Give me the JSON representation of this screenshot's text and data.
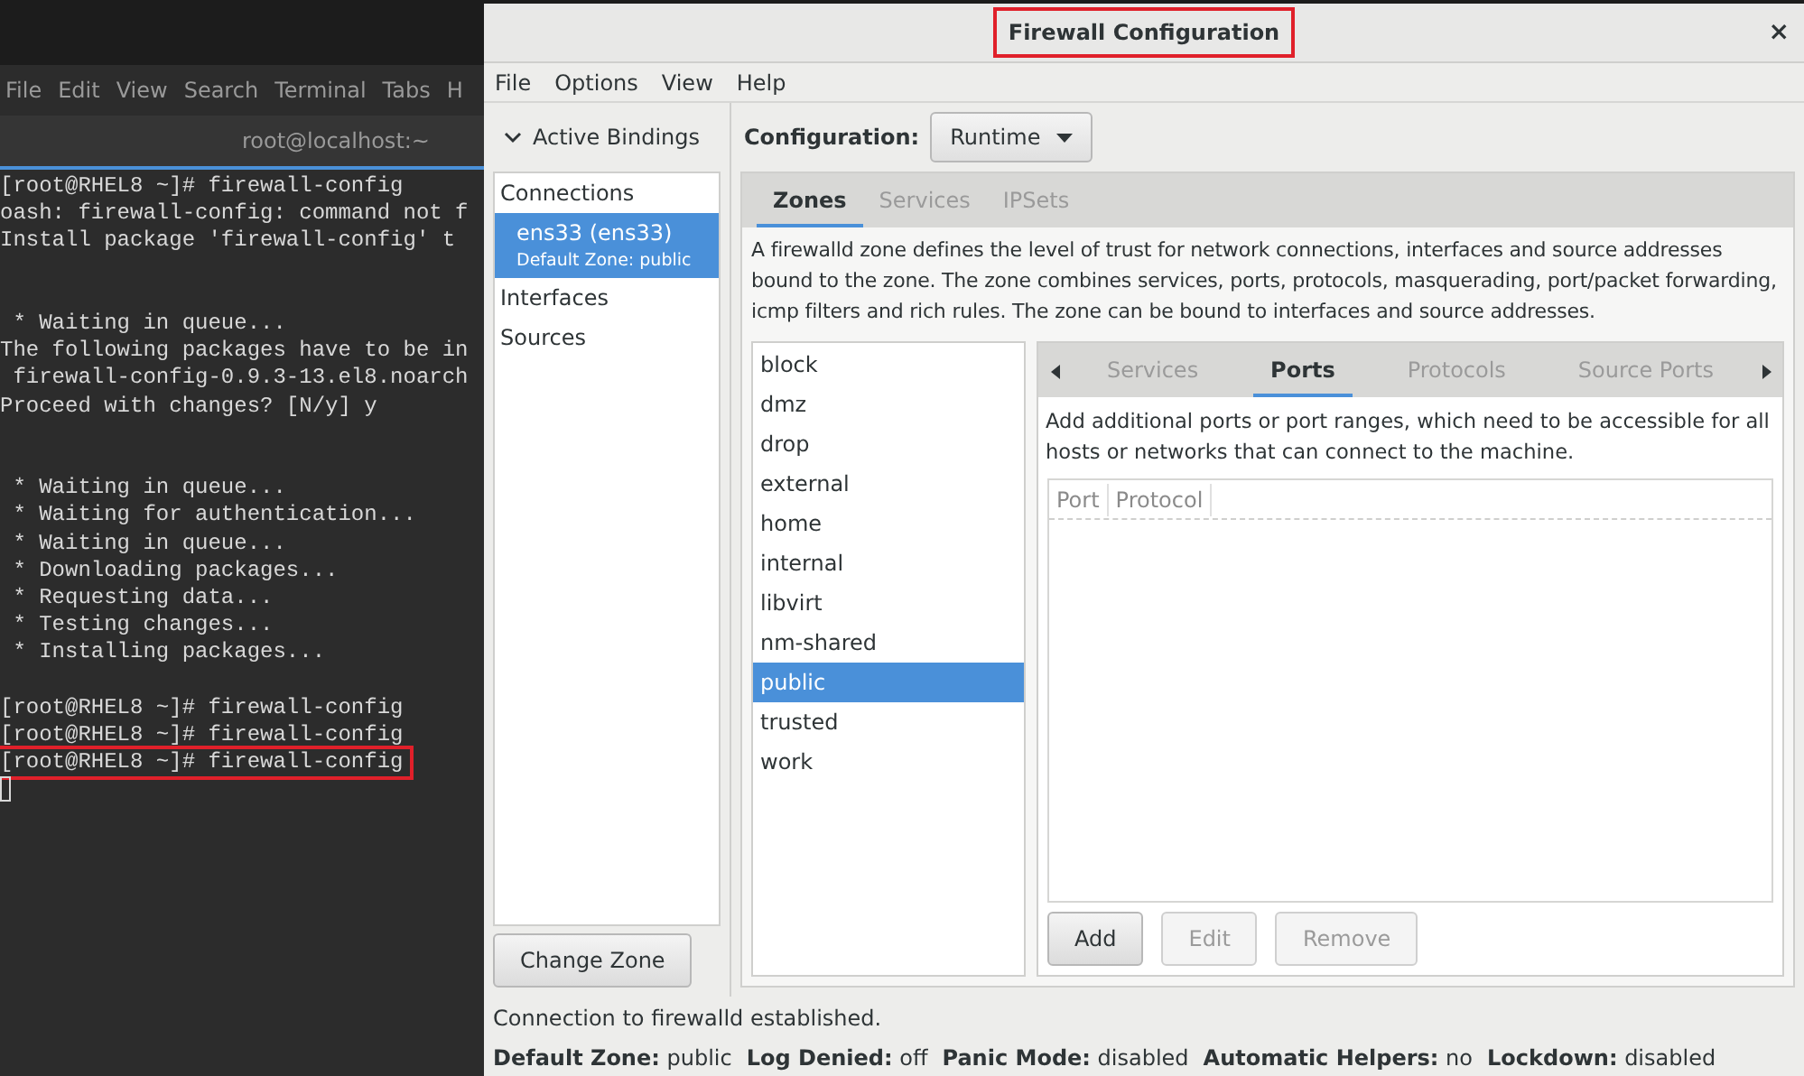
{
  "terminal": {
    "menu": [
      "File",
      "Edit",
      "View",
      "Search",
      "Terminal",
      "Tabs",
      "H"
    ],
    "tab_title": "root@localhost:~",
    "lines": [
      {
        "kind": "text",
        "text": "[root@RHEL8 ~]# firewall-config",
        "highlighted": false
      },
      {
        "kind": "text",
        "text": "oash: firewall-config: command not f",
        "highlighted": false
      },
      {
        "kind": "text",
        "text": "Install package 'firewall-config' t",
        "highlighted": false
      },
      {
        "kind": "blank"
      },
      {
        "kind": "blank"
      },
      {
        "kind": "text",
        "text": " * Waiting in queue...",
        "highlighted": false
      },
      {
        "kind": "text",
        "text": "The following packages have to be in",
        "highlighted": false
      },
      {
        "kind": "text",
        "text": " firewall-config-0.9.3-13.el8.noarch",
        "highlighted": false
      },
      {
        "kind": "text",
        "text": "Proceed with changes? [N/y] y",
        "highlighted": false
      },
      {
        "kind": "blank"
      },
      {
        "kind": "blank"
      },
      {
        "kind": "text",
        "text": " * Waiting in queue...",
        "highlighted": false
      },
      {
        "kind": "text",
        "text": " * Waiting for authentication...",
        "highlighted": false
      },
      {
        "kind": "text",
        "text": " * Waiting in queue...",
        "highlighted": false
      },
      {
        "kind": "text",
        "text": " * Downloading packages...",
        "highlighted": false
      },
      {
        "kind": "text",
        "text": " * Requesting data...",
        "highlighted": false
      },
      {
        "kind": "text",
        "text": " * Testing changes...",
        "highlighted": false
      },
      {
        "kind": "text",
        "text": " * Installing packages...",
        "highlighted": false
      },
      {
        "kind": "blank"
      },
      {
        "kind": "text",
        "text": "[root@RHEL8 ~]# firewall-config",
        "highlighted": false
      },
      {
        "kind": "text",
        "text": "[root@RHEL8 ~]# firewall-config",
        "highlighted": false
      },
      {
        "kind": "text",
        "text": "[root@RHEL8 ~]# firewall-config",
        "highlighted": true
      },
      {
        "kind": "cursor"
      }
    ]
  },
  "window": {
    "title": "Firewall Configuration",
    "title_highlighted": true,
    "close": "×"
  },
  "menu": [
    "File",
    "Options",
    "View",
    "Help"
  ],
  "bindings": {
    "label": "Active Bindings",
    "expanded": true,
    "items": [
      {
        "kind": "header",
        "label": "Connections"
      },
      {
        "kind": "connection",
        "label": "ens33 (ens33)",
        "detail": "Default Zone: public",
        "selected": true
      },
      {
        "kind": "header",
        "label": "Interfaces"
      },
      {
        "kind": "header",
        "label": "Sources"
      }
    ],
    "button": "Change Zone"
  },
  "configuration": {
    "label": "Configuration:",
    "value": "Runtime"
  },
  "tabs": [
    {
      "label": "Zones",
      "selected": true
    },
    {
      "label": "Services",
      "selected": false
    },
    {
      "label": "IPSets",
      "selected": false
    }
  ],
  "description": "A firewalld zone defines the level of trust for network connections, interfaces and source addresses bound to the zone. The zone combines services, ports, protocols, masquerading, port/packet forwarding, icmp filters and rich rules. The zone can be bound to interfaces and source addresses.",
  "zones": [
    {
      "label": "block",
      "selected": false
    },
    {
      "label": "dmz",
      "selected": false
    },
    {
      "label": "drop",
      "selected": false
    },
    {
      "label": "external",
      "selected": false
    },
    {
      "label": "home",
      "selected": false
    },
    {
      "label": "internal",
      "selected": false
    },
    {
      "label": "libvirt",
      "selected": false
    },
    {
      "label": "nm-shared",
      "selected": false
    },
    {
      "label": "public",
      "selected": true
    },
    {
      "label": "trusted",
      "selected": false
    },
    {
      "label": "work",
      "selected": false
    }
  ],
  "zone_tabs": [
    {
      "label": "Services",
      "selected": false
    },
    {
      "label": "Ports",
      "selected": true
    },
    {
      "label": "Protocols",
      "selected": false
    },
    {
      "label": "Source Ports",
      "selected": false
    }
  ],
  "ports": {
    "hint": "Add additional ports or port ranges, which need to be accessible for all hosts or networks that can connect to the machine.",
    "columns": [
      "Port",
      "Protocol"
    ],
    "buttons": [
      {
        "label": "Add",
        "disabled": false
      },
      {
        "label": "Edit",
        "disabled": true
      },
      {
        "label": "Remove",
        "disabled": true
      }
    ]
  },
  "status": {
    "message": "Connection to firewalld established.",
    "items": [
      "**Default Zone:** public",
      "**Log Denied:** off",
      "**Panic Mode:** disabled",
      "**Automatic Helpers:** no",
      "**Lockdown:** disabled"
    ]
  }
}
